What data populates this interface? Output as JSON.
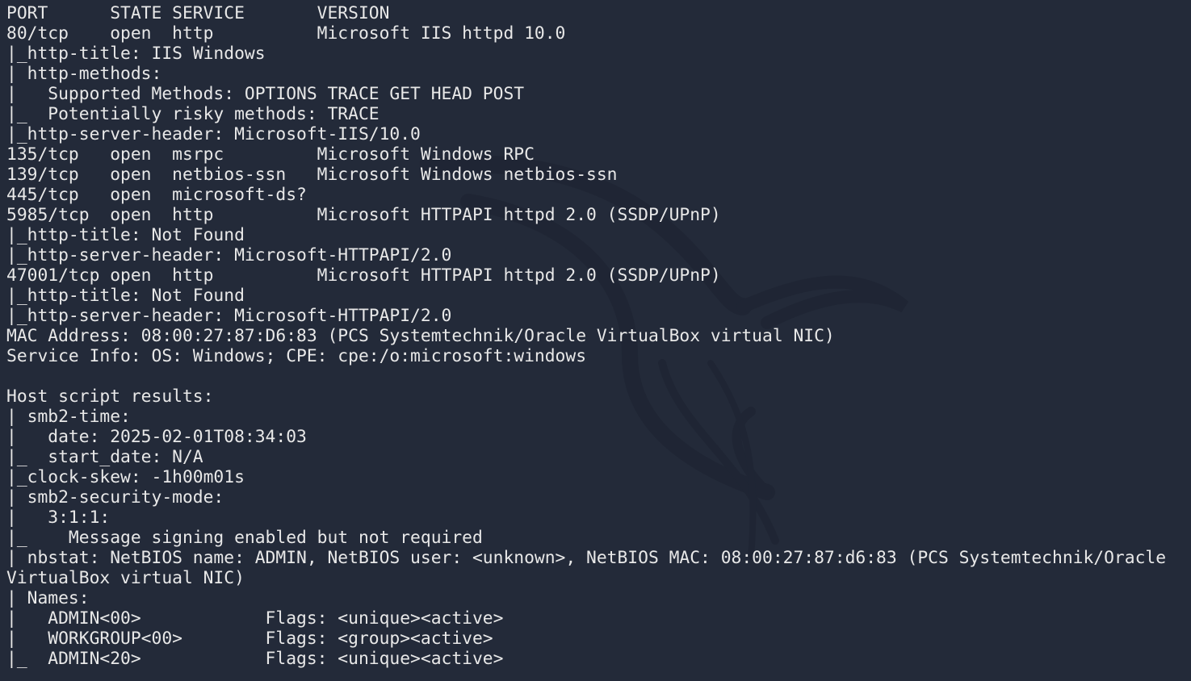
{
  "background_color": "#232a39",
  "text_color": "#e8e8e8",
  "wallpaper_icon": "kali-dragon-icon",
  "lines": [
    "PORT      STATE SERVICE       VERSION",
    "80/tcp    open  http          Microsoft IIS httpd 10.0",
    "|_http-title: IIS Windows",
    "| http-methods: ",
    "|   Supported Methods: OPTIONS TRACE GET HEAD POST",
    "|_  Potentially risky methods: TRACE",
    "|_http-server-header: Microsoft-IIS/10.0",
    "135/tcp   open  msrpc         Microsoft Windows RPC",
    "139/tcp   open  netbios-ssn   Microsoft Windows netbios-ssn",
    "445/tcp   open  microsoft-ds?",
    "5985/tcp  open  http          Microsoft HTTPAPI httpd 2.0 (SSDP/UPnP)",
    "|_http-title: Not Found",
    "|_http-server-header: Microsoft-HTTPAPI/2.0",
    "47001/tcp open  http          Microsoft HTTPAPI httpd 2.0 (SSDP/UPnP)",
    "|_http-title: Not Found",
    "|_http-server-header: Microsoft-HTTPAPI/2.0",
    "MAC Address: 08:00:27:87:D6:83 (PCS Systemtechnik/Oracle VirtualBox virtual NIC)",
    "Service Info: OS: Windows; CPE: cpe:/o:microsoft:windows",
    "",
    "Host script results:",
    "| smb2-time: ",
    "|   date: 2025-02-01T08:34:03",
    "|_  start_date: N/A",
    "|_clock-skew: -1h00m01s",
    "| smb2-security-mode: ",
    "|   3:1:1: ",
    "|_    Message signing enabled but not required",
    "| nbstat: NetBIOS name: ADMIN, NetBIOS user: <unknown>, NetBIOS MAC: 08:00:27:87:d6:83 (PCS Systemtechnik/Oracle",
    "VirtualBox virtual NIC)",
    "| Names:",
    "|   ADMIN<00>            Flags: <unique><active>",
    "|   WORKGROUP<00>        Flags: <group><active>",
    "|_  ADMIN<20>            Flags: <unique><active>"
  ]
}
